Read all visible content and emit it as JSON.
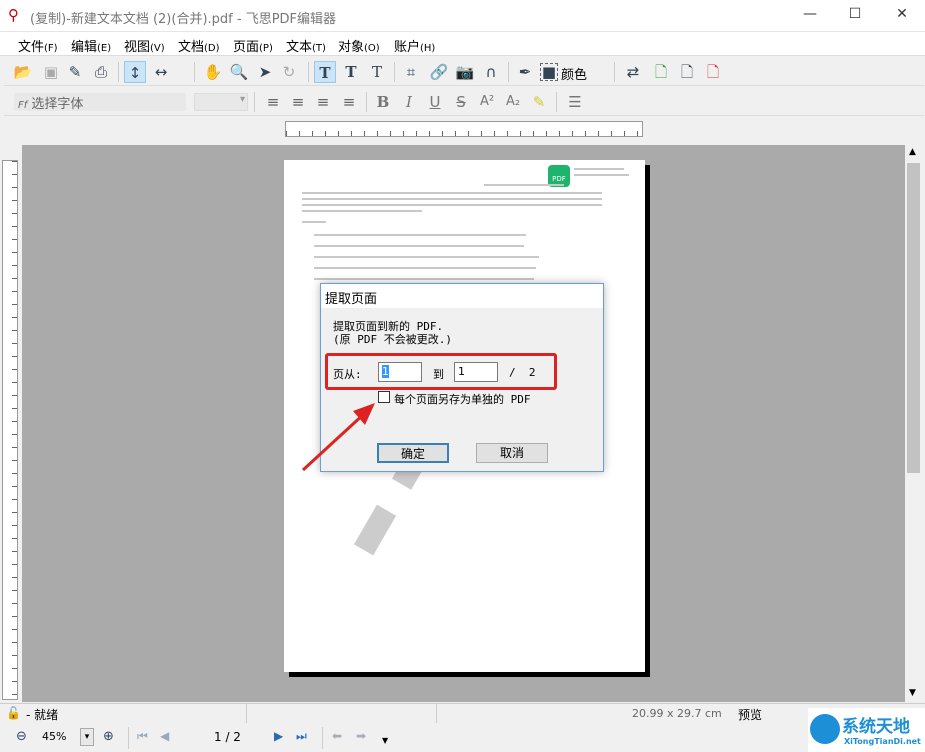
{
  "window": {
    "title": "(复制)-新建文本文档 (2)(合并).pdf - 飞思PDF编辑器",
    "minimize": "—",
    "maximize": "☐",
    "close": "✕"
  },
  "menu": [
    {
      "label": "文件",
      "key": "(F)"
    },
    {
      "label": "编辑",
      "key": "(E)"
    },
    {
      "label": "视图",
      "key": "(V)"
    },
    {
      "label": "文档",
      "key": "(D)"
    },
    {
      "label": "页面",
      "key": "(P)"
    },
    {
      "label": "文本",
      "key": "(T)"
    },
    {
      "label": "对象",
      "key": "(O)"
    },
    {
      "label": "账户",
      "key": "(H)"
    }
  ],
  "toolbar": {
    "color_label": "颜色"
  },
  "format_toolbar": {
    "font_placeholder": "选择字体",
    "bold": "B",
    "italic": "I",
    "underline": "U",
    "strike": "S",
    "superscript": "A²",
    "subscript": "A₂"
  },
  "page_content": {
    "logo_text": "PDF"
  },
  "dialog": {
    "title": "提取页面",
    "message_line1": "提取页面到新的 PDF.",
    "message_line2": "(原 PDF 不会被更改.)",
    "from_label": "页从:",
    "from_value": "1",
    "to_label": "到",
    "to_value": "1",
    "total": "/  2",
    "checkbox_label": "每个页面另存为单独的 PDF",
    "checkbox_checked": false,
    "ok": "确定",
    "cancel": "取消"
  },
  "annotation": {
    "color": "#dd2222"
  },
  "status": {
    "text": "- 就绪",
    "page_size": "20.99 x 29.7 cm",
    "mode": "预览"
  },
  "bottom": {
    "zoom": "45%",
    "page": "1 / 2"
  },
  "watermark": {
    "text": "系统天地",
    "url": "XiTongTianDi.net"
  }
}
